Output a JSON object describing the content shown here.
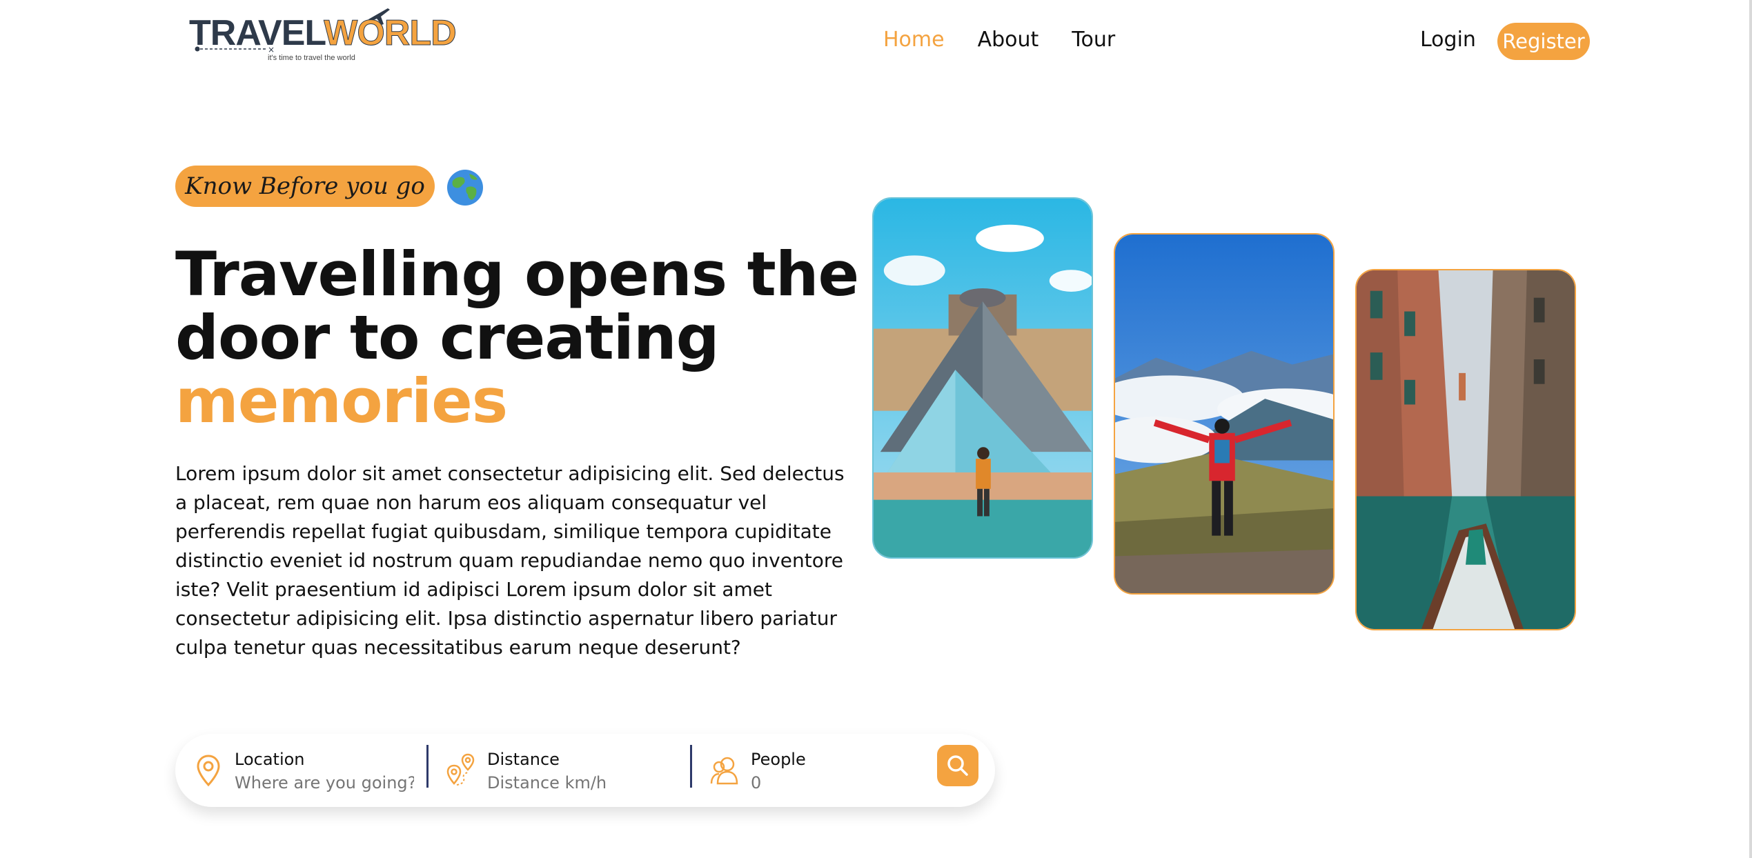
{
  "header": {
    "logo": {
      "word1": "TRAVEL",
      "word2": "WORLD",
      "tagline": "it's time to travel the world"
    },
    "nav": [
      {
        "label": "Home",
        "active": true
      },
      {
        "label": "About",
        "active": false
      },
      {
        "label": "Tour",
        "active": false
      }
    ],
    "login_label": "Login",
    "register_label": "Register"
  },
  "hero": {
    "badge": "Know Before you go",
    "globe_icon": "globe-icon",
    "title_line1": "Travelling opens the",
    "title_line2": "door to creating",
    "title_accent": "memories",
    "description": "Lorem ipsum dolor sit amet consectetur adipisicing elit. Sed delectus a placeat, rem quae non harum eos aliquam consequatur vel perferendis repellat fugiat quibusdam, similique tempora cupiditate distinctio eveniet id nostrum quam repudiandae nemo quo inventore iste? Velit praesentium id adipisci Lorem ipsum dolor sit amet consectetur adipisicing elit. Ipsa distinctio aspernatur libero pariatur culpa tenetur quas necessitatibus earum neque deserunt?"
  },
  "search": {
    "location": {
      "label": "Location",
      "placeholder": "Where are you going?",
      "icon": "map-pin-icon"
    },
    "distance": {
      "label": "Distance",
      "placeholder": "Distance km/h",
      "icon": "route-pins-icon"
    },
    "people": {
      "label": "People",
      "placeholder": "0",
      "icon": "people-icon"
    },
    "button_icon": "search-icon"
  },
  "images": [
    {
      "name": "louvre-pyramid-photo"
    },
    {
      "name": "mountain-hiker-photo"
    },
    {
      "name": "venice-canal-photo"
    }
  ],
  "colors": {
    "accent": "#f4a340",
    "text": "#111111",
    "divider": "#2e3a6a"
  }
}
